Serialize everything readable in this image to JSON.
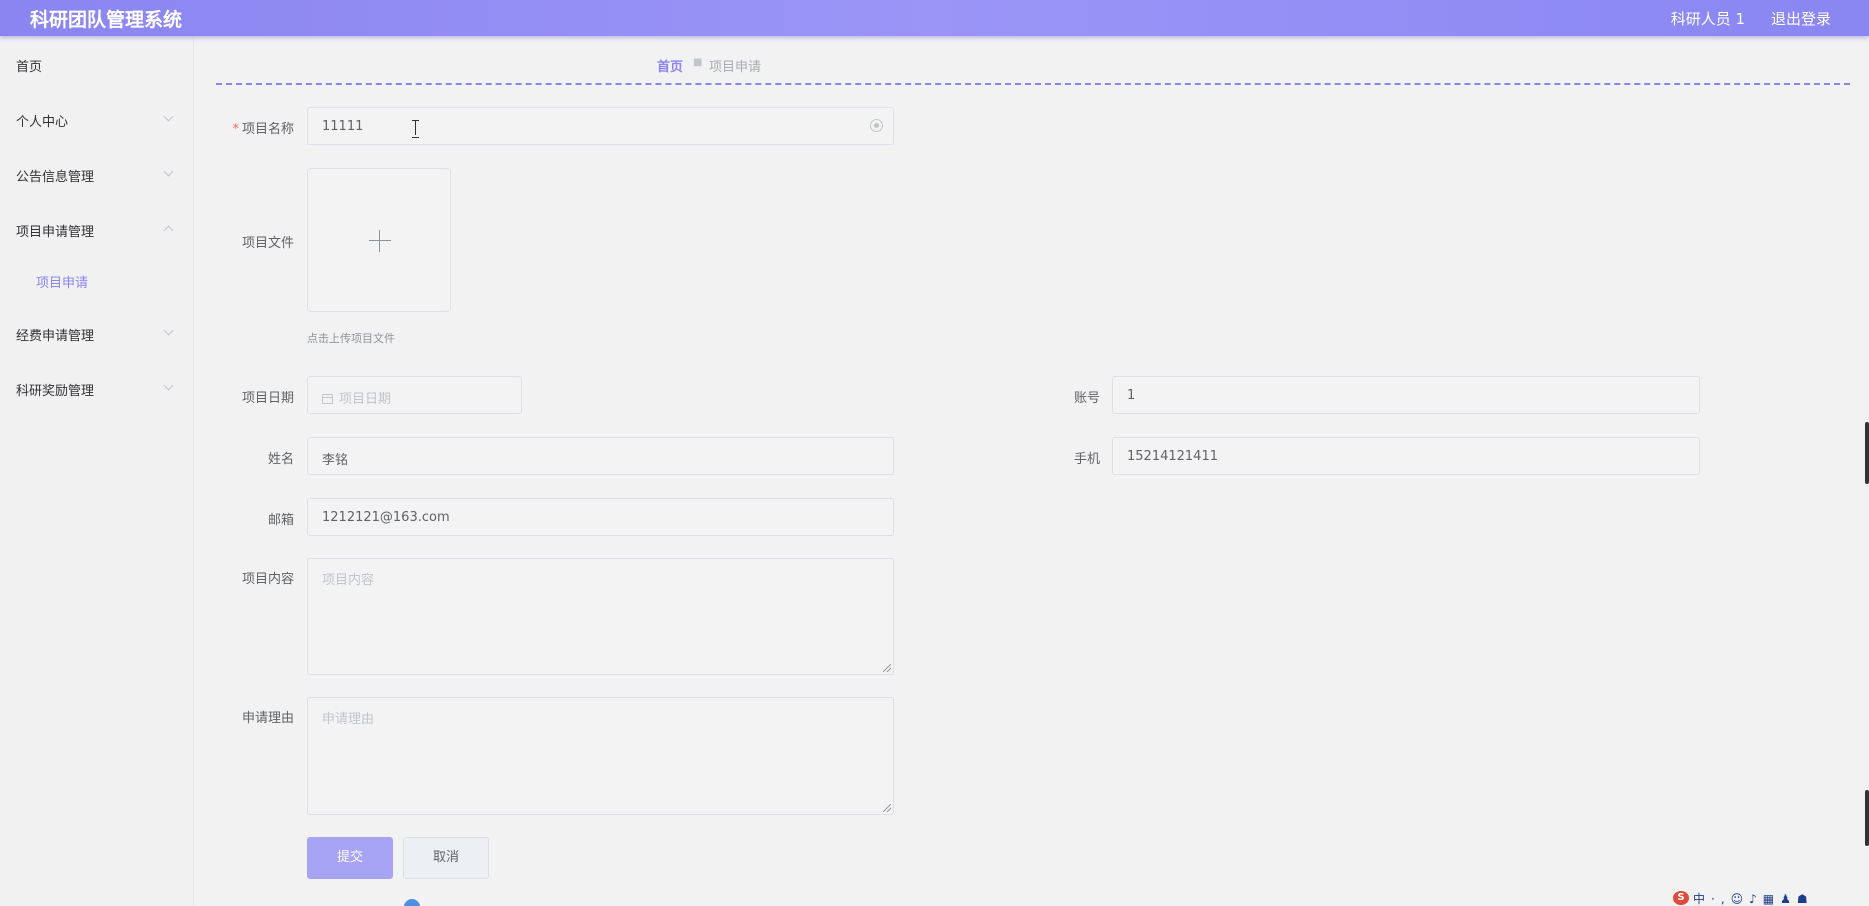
{
  "header": {
    "app_title": "科研团队管理系统",
    "user_name": "科研人员 1",
    "logout_label": "退出登录"
  },
  "sidebar": {
    "items": [
      {
        "label": "首页"
      },
      {
        "label": "个人中心"
      },
      {
        "label": "公告信息管理"
      },
      {
        "label": "项目申请管理"
      },
      {
        "label": "经费申请管理"
      },
      {
        "label": "科研奖励管理"
      }
    ],
    "submenu": {
      "label": "项目申请"
    }
  },
  "breadcrumb": {
    "home": "首页",
    "separator": "■",
    "current": "项目申请"
  },
  "form": {
    "project_name": {
      "label": "项目名称",
      "value": "11111"
    },
    "project_file": {
      "label": "项目文件",
      "tip": "点击上传项目文件"
    },
    "project_date": {
      "label": "项目日期",
      "placeholder": "项目日期"
    },
    "account": {
      "label": "账号",
      "value": "1"
    },
    "name": {
      "label": "姓名",
      "value": "李铭"
    },
    "phone": {
      "label": "手机",
      "value": "15214121411"
    },
    "email": {
      "label": "邮箱",
      "value": "1212121@163.com"
    },
    "project_content": {
      "label": "项目内容",
      "placeholder": "项目内容"
    },
    "reason": {
      "label": "申请理由",
      "placeholder": "申请理由"
    },
    "submit_label": "提交",
    "cancel_label": "取消"
  },
  "taskbar": {
    "ime_logo": "S",
    "ime_text": "中·,☺♪▦♟☗"
  },
  "colors": {
    "accent": "#8a85f0",
    "header_bg": "#9a95f7",
    "required": "#f56c6c"
  }
}
